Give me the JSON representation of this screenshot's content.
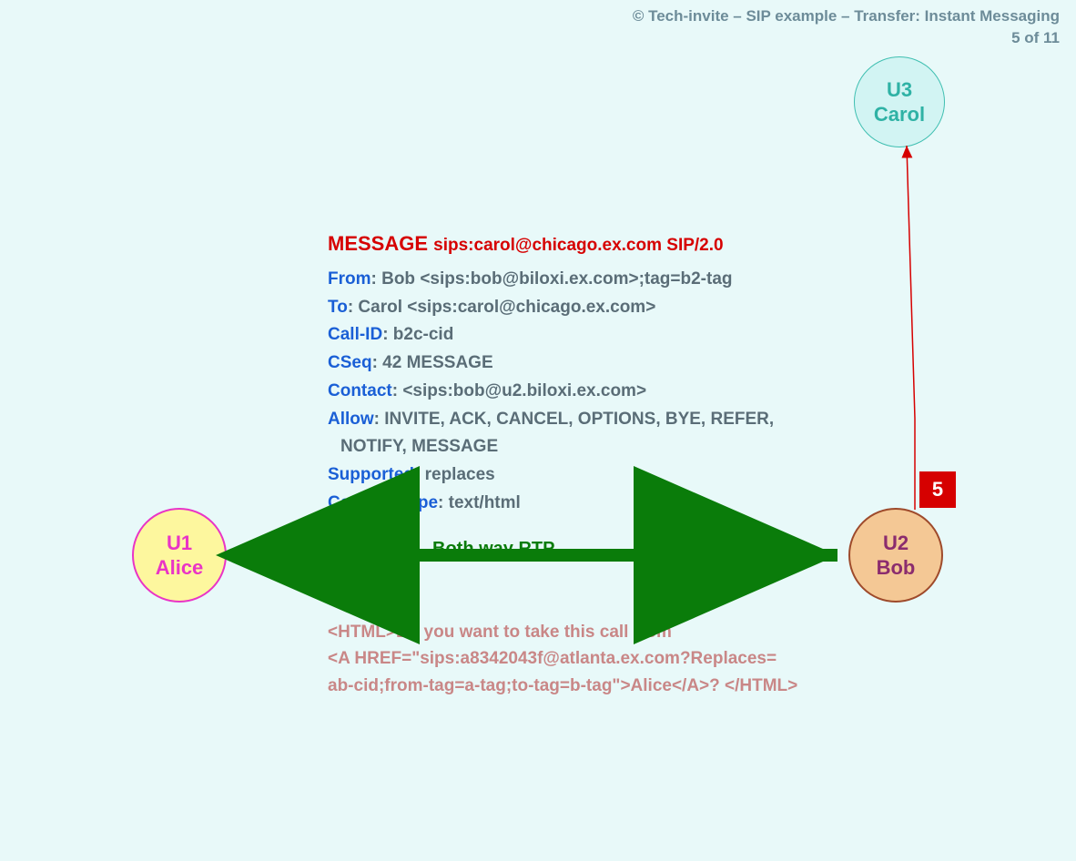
{
  "header": {
    "copyright": "© Tech-invite – SIP example – Transfer: Instant Messaging",
    "page_of": "5 of 11"
  },
  "nodes": {
    "u3": {
      "id": "U3",
      "name": "Carol"
    },
    "u1": {
      "id": "U1",
      "name": "Alice"
    },
    "u2": {
      "id": "U2",
      "name": "Bob"
    }
  },
  "step": "5",
  "rtp_label": "Both way RTP",
  "message": {
    "method": "MESSAGE",
    "request_uri": "sips:carol@chicago.ex.com SIP/2.0",
    "headers": {
      "From": {
        "label": "From",
        "value": ": Bob <sips:bob@biloxi.ex.com>;tag=b2-tag"
      },
      "To": {
        "label": "To",
        "value": ": Carol <sips:carol@chicago.ex.com>"
      },
      "Call-ID": {
        "label": "Call-ID",
        "value": ": b2c-cid"
      },
      "CSeq": {
        "label": "CSeq",
        "value": ": 42 MESSAGE"
      },
      "Contact": {
        "label": "Contact",
        "value": ": <sips:bob@u2.biloxi.ex.com>"
      },
      "Allow": {
        "label": "Allow",
        "value": ": INVITE, ACK, CANCEL, OPTIONS, BYE, REFER,"
      },
      "Allow2": {
        "value": "NOTIFY, MESSAGE"
      },
      "Supported": {
        "label": "Supported",
        "value": ": replaces"
      },
      "Content-Type": {
        "label": "Content-Type",
        "value": ": text/html"
      }
    }
  },
  "body_html": {
    "l1": "<HTML>Do you want to take this call from",
    "l2": "<A HREF=\"sips:a8342043f@atlanta.ex.com?Replaces=",
    "l3": " ab-cid;from-tag=a-tag;to-tag=b-tag\">Alice</A>? </HTML>"
  }
}
